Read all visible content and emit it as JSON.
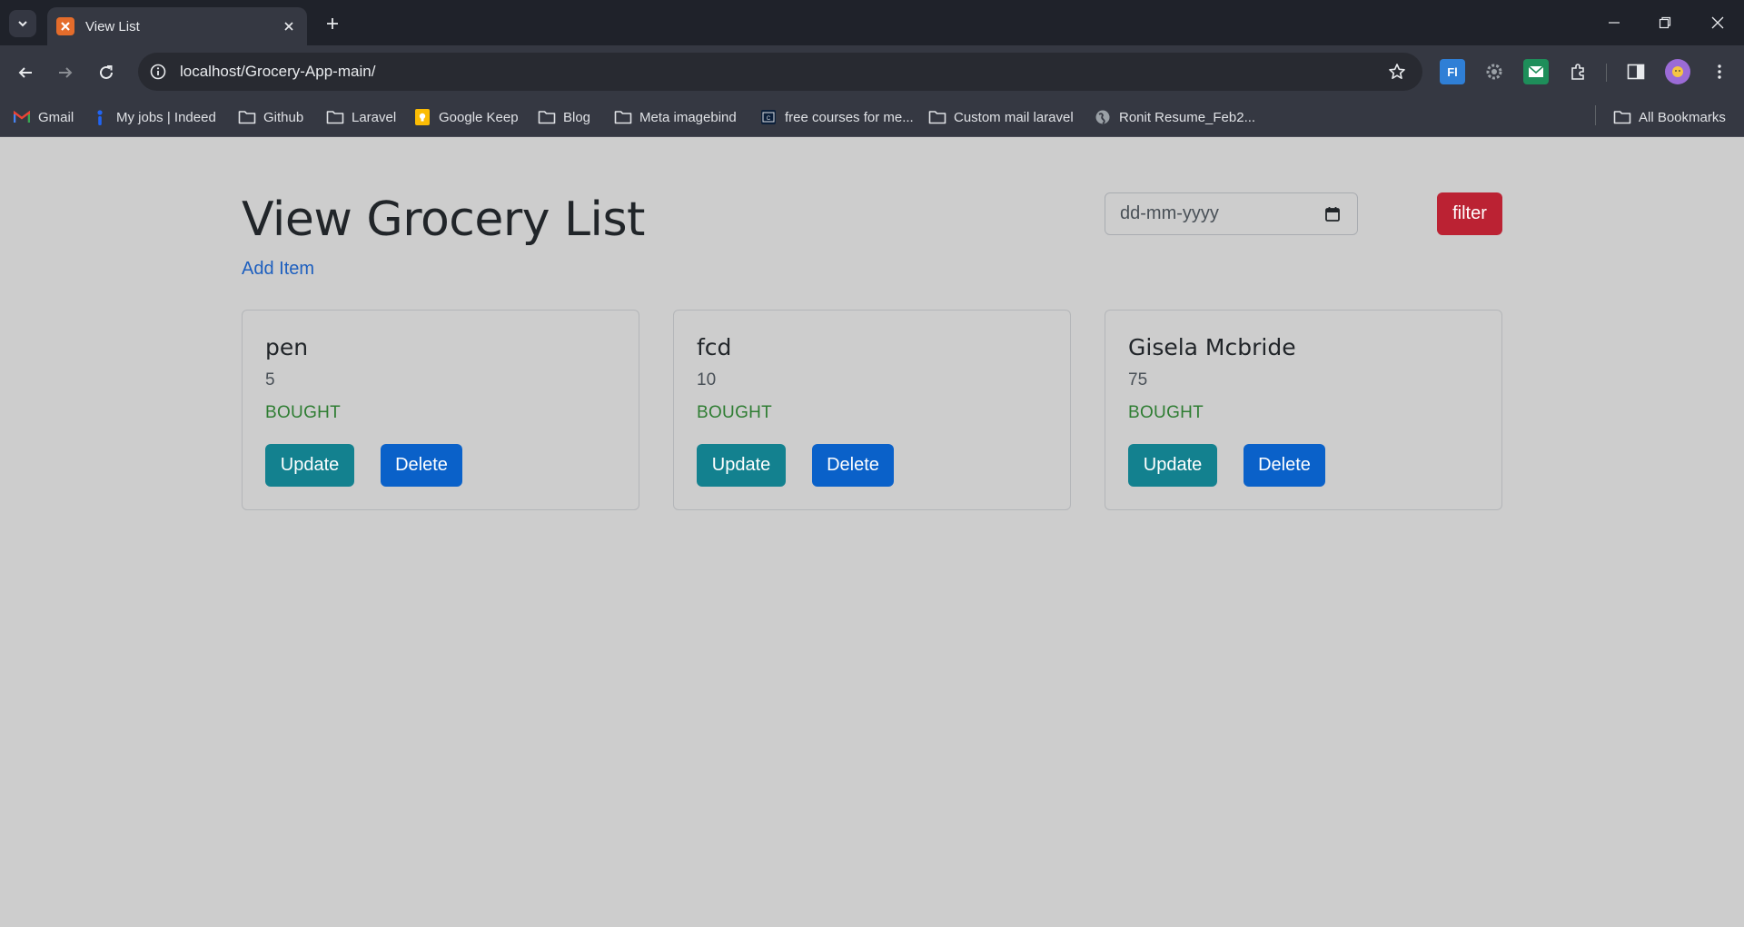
{
  "browser": {
    "tab_title": "View List",
    "url": "localhost/Grocery-App-main/",
    "bookmarks": [
      {
        "label": "Gmail",
        "icon": "gmail-icon"
      },
      {
        "label": "My jobs | Indeed",
        "icon": "indeed-icon"
      },
      {
        "label": "Github",
        "icon": "folder-icon"
      },
      {
        "label": "Laravel",
        "icon": "folder-icon"
      },
      {
        "label": "Google Keep",
        "icon": "google-keep-icon"
      },
      {
        "label": "Blog",
        "icon": "folder-icon"
      },
      {
        "label": "Meta imagebind",
        "icon": "folder-icon"
      },
      {
        "label": "free courses for me...",
        "icon": "courses-icon"
      },
      {
        "label": "Custom mail laravel",
        "icon": "folder-icon"
      },
      {
        "label": "Ronit Resume_Feb2...",
        "icon": "globe-icon"
      }
    ],
    "all_bookmarks": "All Bookmarks",
    "extensions": [
      "fl-extension-icon",
      "gear-extension-icon",
      "mail-extension-icon",
      "puzzle-extensions-icon"
    ]
  },
  "page": {
    "title": "View Grocery List",
    "add_link": "Add Item",
    "date_placeholder": "dd-mm-yyyy",
    "filter_label": "filter"
  },
  "items": [
    {
      "name": "pen",
      "quantity": "5",
      "status": "BOUGHT",
      "update_label": "Update",
      "delete_label": "Delete"
    },
    {
      "name": "fcd",
      "quantity": "10",
      "status": "BOUGHT",
      "update_label": "Update",
      "delete_label": "Delete"
    },
    {
      "name": "Gisela Mcbride",
      "quantity": "75",
      "status": "BOUGHT",
      "update_label": "Update",
      "delete_label": "Delete"
    }
  ],
  "colors": {
    "filter": "#bb2233",
    "update": "#13818f",
    "delete": "#0a61c9",
    "status": "#2e7d32",
    "link": "#1d5fbf"
  }
}
